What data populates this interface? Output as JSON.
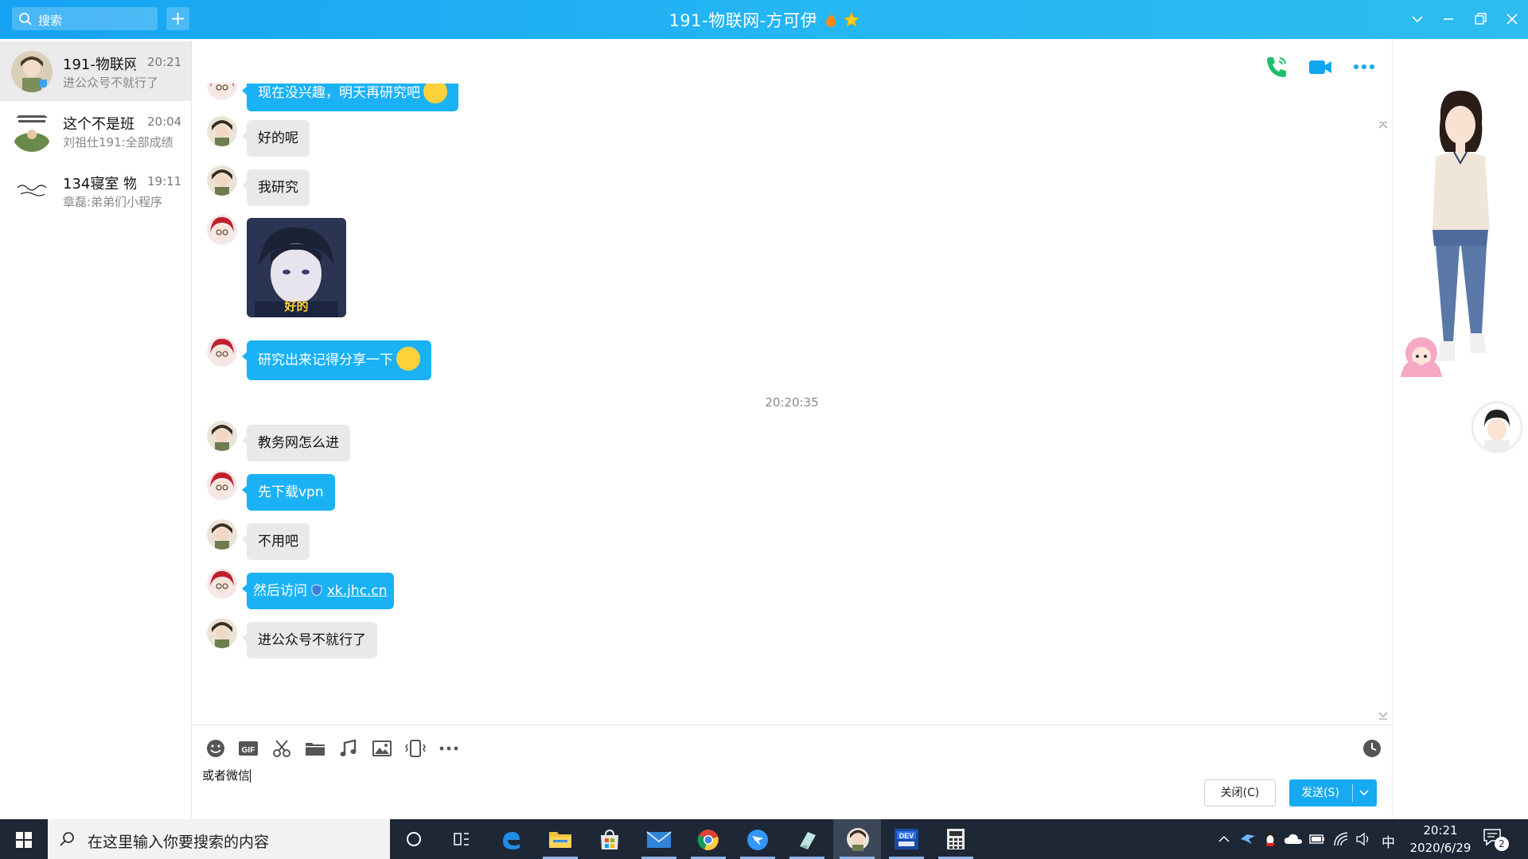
{
  "window": {
    "title": "191-物联网-方可伊",
    "search_placeholder": "搜索"
  },
  "conversations": [
    {
      "name": "191-物联网",
      "time": "20:21",
      "preview": "进公众号不就行了",
      "active": true
    },
    {
      "name": "这个不是班",
      "time": "20:04",
      "preview": "刘祖仕191:全部成绩",
      "active": false
    },
    {
      "name": "134寝室 物",
      "time": "19:11",
      "preview": "章磊:弟弟们小程序",
      "active": false
    }
  ],
  "messages": {
    "m1": "现在没兴趣，明天再研究吧",
    "m2": "好的呢",
    "m3": "我研究",
    "sticker_caption": "好的",
    "m4": "研究出来记得分享一下",
    "timestamp": "20:20:35",
    "m5": "教务网怎么进",
    "m6": "先下载vpn",
    "m7": "不用吧",
    "m8_prefix": "然后访问",
    "m8_link": "xk.jhc.cn",
    "m9": "进公众号不就行了"
  },
  "composer": {
    "draft": "或者微信",
    "close_label": "关闭(C)",
    "send_label": "发送(S)"
  },
  "taskbar": {
    "search_placeholder": "在这里输入你要搜索的内容",
    "ime": "中",
    "time": "20:21",
    "date": "2020/6/29",
    "notif_count": "2"
  },
  "icons": {
    "toolbar": [
      "emoji-icon",
      "gif-icon",
      "scissors-icon",
      "folder-icon",
      "music-icon",
      "image-icon",
      "shake-icon",
      "more-icon"
    ],
    "history": "clock-icon",
    "call": [
      "phone-icon",
      "video-icon",
      "more-icon"
    ]
  },
  "colors": {
    "accent": "#1ab2f5",
    "titlebar": "#1fb0f4",
    "taskbar": "#1d2736"
  }
}
